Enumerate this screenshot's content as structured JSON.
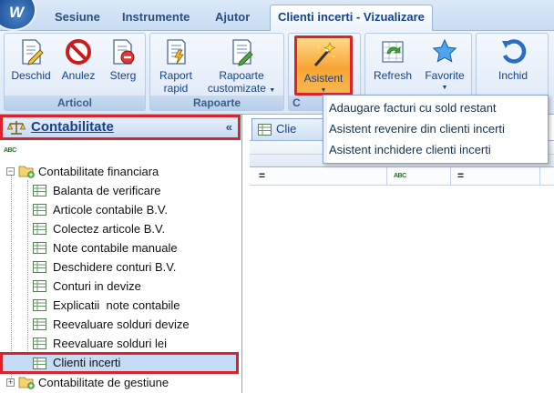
{
  "tabs": [
    {
      "label": "Sesiune"
    },
    {
      "label": "Instrumente"
    },
    {
      "label": "Ajutor"
    },
    {
      "label": "Clienti incerti - Vizualizare"
    }
  ],
  "ribbon": {
    "groups": {
      "articol": {
        "label": "Articol",
        "buttons": {
          "deschid": "Deschid",
          "anulez": "Anulez",
          "sterg": "Sterg"
        }
      },
      "rapoarte": {
        "label": "Rapoarte",
        "buttons": {
          "raport_rapid_1": "Raport",
          "raport_rapid_2": "rapid",
          "rapoarte_custom_1": "Rapoarte",
          "rapoarte_custom_2": "customizate"
        }
      },
      "asistent": {
        "label": "C",
        "button": "Asistent"
      },
      "misc": {
        "buttons": {
          "refresh": "Refresh",
          "favorite": "Favorite"
        }
      },
      "inchid": {
        "button": "Inchid"
      }
    }
  },
  "asistent_menu": {
    "items": [
      "Adaugare facturi cu sold restant",
      "Asistent revenire din clienti incerti",
      "Asistent inchidere clienti incerti"
    ]
  },
  "nav": {
    "title": "Contabilitate",
    "collapse": "«",
    "filter_icon": "ABC",
    "tree": {
      "group1": "Contabilitate financiara",
      "items": [
        "Balanta de verificare",
        "Articole contabile B.V.",
        "Colectez articole B.V.",
        "Note contabile manuale",
        "Deschidere conturi B.V.",
        "Conturi in devize",
        "Explicatii  note contabile",
        "Reevaluare solduri devize",
        "Reevaluare solduri lei",
        "Clienti incerti"
      ],
      "group2": "Contabilitate de gestiune"
    }
  },
  "content": {
    "tab_label": "Clie",
    "filter_ops": [
      "=",
      "ABC",
      "="
    ]
  },
  "colors": {
    "accent_red": "#d9232d",
    "ribbon_blue": "#15428b",
    "selected_bg": "#c5dcf7"
  }
}
